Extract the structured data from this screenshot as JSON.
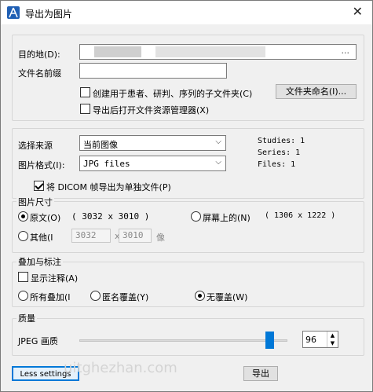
{
  "window": {
    "title": "导出为图片"
  },
  "destination": {
    "label": "目的地(D):",
    "browse_label": "...",
    "prefix_label": "文件名前缀",
    "prefix_value": "",
    "create_subfolder_label": "创建用于患者、研判、序列的子文件夹(C)",
    "create_subfolder_checked": false,
    "folder_naming_button": "文件夹命名(I)...",
    "open_explorer_label": "导出后打开文件资源管理器(X)",
    "open_explorer_checked": false
  },
  "source": {
    "label": "选择来源",
    "value": "当前图像",
    "format_label": "图片格式(I):",
    "format_value": "JPG files",
    "studies": "Studies: 1",
    "series": "Series: 1",
    "files": "Files: 1",
    "dicom_frames_label": "将 DICOM 帧导出为单独文件(P)",
    "dicom_frames_checked": true
  },
  "size": {
    "group_label": "图片尺寸",
    "original_label": "原文(O)",
    "original_dims": "( 3032 x 3010 )",
    "original_selected": true,
    "screen_label": "屏幕上的(N)",
    "screen_dims": "( 1306 x 1222 )",
    "screen_selected": false,
    "other_label": "其他(I",
    "other_selected": false,
    "other_width": "3032",
    "times": "x",
    "other_height": "3010",
    "unit": "像"
  },
  "overlay": {
    "group_label": "叠加与标注",
    "show_annotations_label": "显示注释(A)",
    "show_annotations_checked": false,
    "all_overlays_label": "所有叠加(I",
    "all_overlays_selected": false,
    "anonymous_overlay_label": "匿名覆盖(Y)",
    "anonymous_overlay_selected": false,
    "no_overlay_label": "无覆盖(W)",
    "no_overlay_selected": true
  },
  "quality": {
    "group_label": "质量",
    "jpeg_label": "JPEG 画质",
    "value": "96",
    "level": 0.96
  },
  "footer": {
    "less_settings_label": "Less settings",
    "export_button": "导出",
    "watermark": "uitghezhan.com"
  }
}
